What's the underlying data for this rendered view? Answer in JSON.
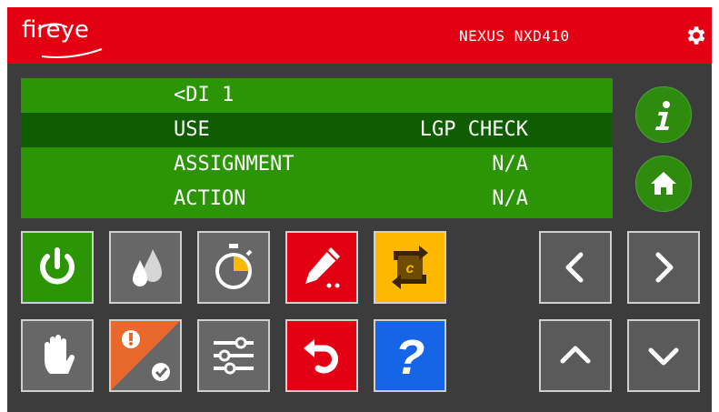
{
  "header": {
    "brand": "fireye",
    "model": "NEXUS NXD410",
    "bg_color": "#e20012"
  },
  "screen": {
    "rows": [
      {
        "label": "<DI 1",
        "value": "",
        "selected": false
      },
      {
        "label": "USE",
        "value": "LGP CHECK",
        "selected": true
      },
      {
        "label": "ASSIGNMENT",
        "value": "N/A",
        "selected": false
      },
      {
        "label": "ACTION",
        "value": "N/A",
        "selected": false
      }
    ]
  },
  "side_buttons": [
    {
      "name": "info",
      "icon": "info-icon",
      "glyph": "i"
    },
    {
      "name": "home",
      "icon": "home-icon"
    }
  ],
  "keypad": [
    {
      "name": "power",
      "icon": "power-icon",
      "color": "#2b9506"
    },
    {
      "name": "flame",
      "icon": "flame-drops-icon",
      "color": "#676767"
    },
    {
      "name": "timer",
      "icon": "stopwatch-icon",
      "color": "#676767"
    },
    {
      "name": "edit",
      "icon": "pencil-icon",
      "color": "#e20012"
    },
    {
      "name": "cycle",
      "icon": "cycle-c-icon",
      "color": "#ffb800"
    },
    {
      "name": "manual",
      "icon": "hand-icon",
      "color": "#676767"
    },
    {
      "name": "alarm",
      "icon": "alarm-check-icon",
      "color": "#e9692c"
    },
    {
      "name": "settings",
      "icon": "sliders-icon",
      "color": "#676767"
    },
    {
      "name": "undo",
      "icon": "undo-icon",
      "color": "#e20012"
    },
    {
      "name": "help",
      "icon": "question-icon",
      "glyph": "?",
      "color": "#1665e6"
    }
  ],
  "navigation": [
    {
      "name": "left",
      "icon": "chevron-left-icon"
    },
    {
      "name": "right",
      "icon": "chevron-right-icon"
    },
    {
      "name": "up",
      "icon": "chevron-up-icon"
    },
    {
      "name": "down",
      "icon": "chevron-down-icon"
    }
  ]
}
